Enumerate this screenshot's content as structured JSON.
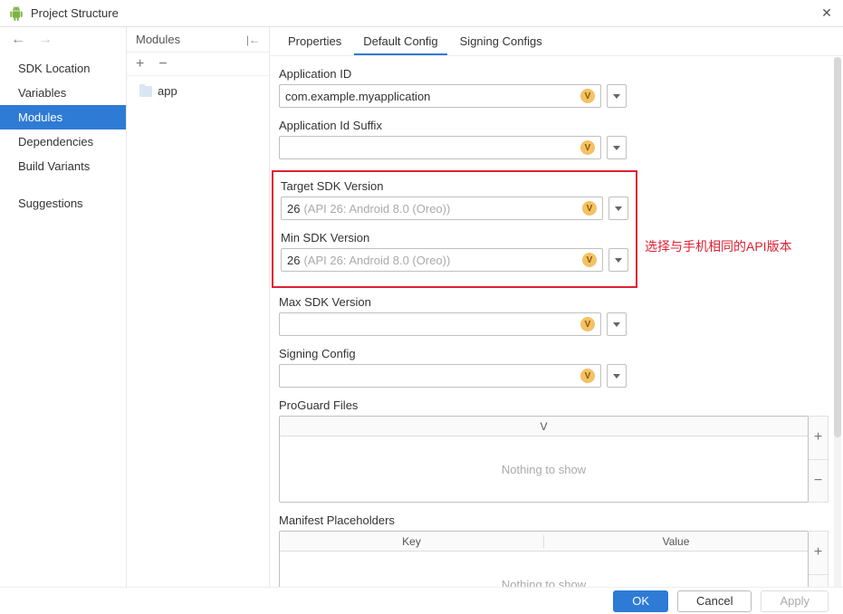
{
  "window": {
    "title": "Project Structure"
  },
  "leftnav": {
    "items": [
      {
        "label": "SDK Location",
        "selected": false
      },
      {
        "label": "Variables",
        "selected": false
      },
      {
        "label": "Modules",
        "selected": true
      },
      {
        "label": "Dependencies",
        "selected": false
      },
      {
        "label": "Build Variants",
        "selected": false
      }
    ],
    "suggestions": "Suggestions"
  },
  "modules": {
    "header": "Modules",
    "items": [
      {
        "label": "app"
      }
    ]
  },
  "tabs": [
    {
      "label": "Properties",
      "active": false
    },
    {
      "label": "Default Config",
      "active": true
    },
    {
      "label": "Signing Configs",
      "active": false
    }
  ],
  "form": {
    "application_id": {
      "label": "Application ID",
      "value": "com.example.myapplication"
    },
    "application_id_suffix": {
      "label": "Application Id Suffix",
      "value": ""
    },
    "target_sdk": {
      "label": "Target SDK Version",
      "value": "26",
      "hint": "(API 26: Android 8.0 (Oreo))"
    },
    "min_sdk": {
      "label": "Min SDK Version",
      "value": "26",
      "hint": "(API 26: Android 8.0 (Oreo))"
    },
    "max_sdk": {
      "label": "Max SDK Version",
      "value": ""
    },
    "signing_config": {
      "label": "Signing Config",
      "value": ""
    },
    "proguard": {
      "label": "ProGuard Files",
      "col": "V",
      "empty": "Nothing to show"
    },
    "manifest": {
      "label": "Manifest Placeholders",
      "col1": "Key",
      "col2": "Value",
      "empty": "Nothing to show"
    }
  },
  "annotation": "选择与手机相同的API版本",
  "footer": {
    "ok": "OK",
    "cancel": "Cancel",
    "apply": "Apply"
  }
}
